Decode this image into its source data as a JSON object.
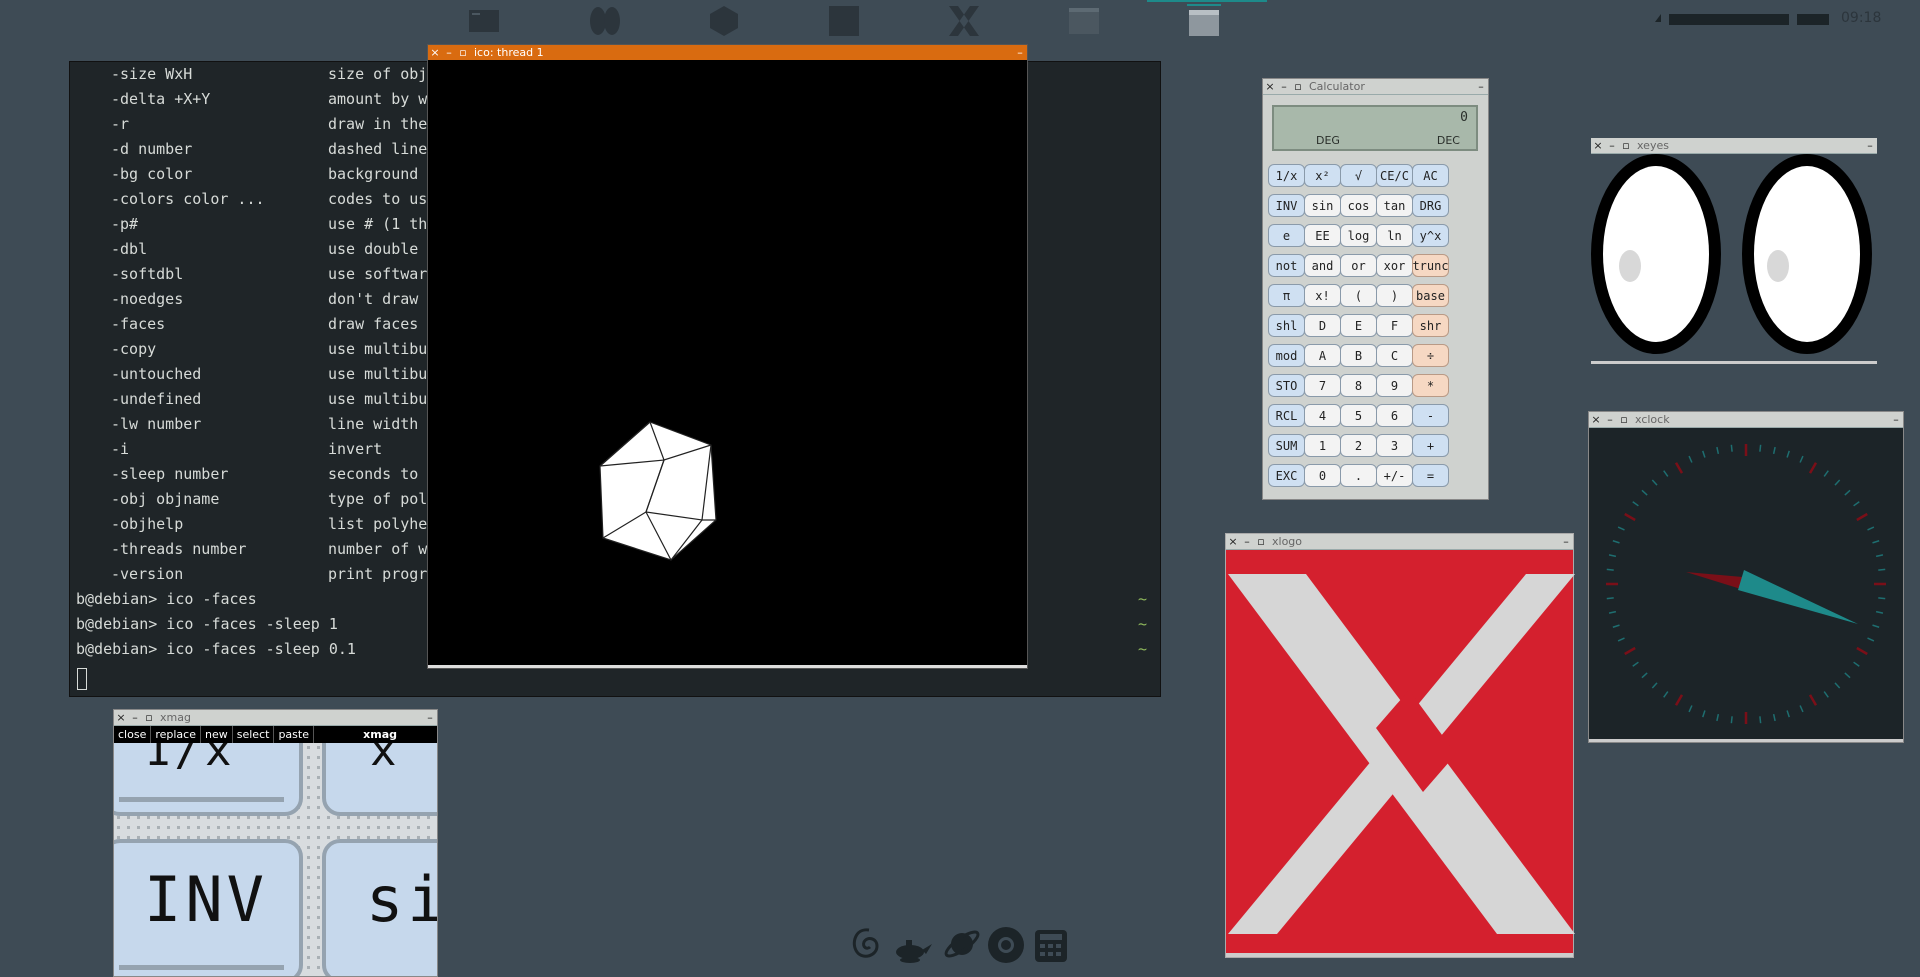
{
  "topbar": {
    "clock": "09:18"
  },
  "terminal": {
    "options": [
      {
        "name": "-size WxH",
        "desc": "size of obj"
      },
      {
        "name": "-delta +X+Y",
        "desc": "amount by w"
      },
      {
        "name": "-r",
        "desc": "draw in the"
      },
      {
        "name": "-d number",
        "desc": "dashed line"
      },
      {
        "name": "-bg color",
        "desc": "background"
      },
      {
        "name": "-colors color ...",
        "desc": "codes to us"
      },
      {
        "name": "-p#",
        "desc": "use # (1 th"
      },
      {
        "name": "-dbl",
        "desc": "use double"
      },
      {
        "name": "-softdbl",
        "desc": "use softwar"
      },
      {
        "name": "-noedges",
        "desc": "don't draw"
      },
      {
        "name": "-faces",
        "desc": "draw faces"
      },
      {
        "name": "-copy",
        "desc": "use multibu"
      },
      {
        "name": "-untouched",
        "desc": "use multibu"
      },
      {
        "name": "-undefined",
        "desc": "use multibu"
      },
      {
        "name": "-lw number",
        "desc": "line width"
      },
      {
        "name": "-i",
        "desc": "invert"
      },
      {
        "name": "-sleep number",
        "desc": "seconds to"
      },
      {
        "name": "-obj objname",
        "desc": "type of pol"
      },
      {
        "name": "-objhelp",
        "desc": "list polyhe"
      },
      {
        "name": "-threads number",
        "desc": "number of w"
      },
      {
        "name": "-version",
        "desc": "print progr"
      }
    ],
    "prompts": [
      "b@debian> ico -faces",
      "b@debian> ico -faces -sleep 1",
      "b@debian> ico -faces -sleep 0.1"
    ],
    "tilde": "~"
  },
  "ico": {
    "title": "ico: thread 1"
  },
  "calculator": {
    "title": "Calculator",
    "display_value": "0",
    "deg": "DEG",
    "dec": "DEC",
    "buttons": [
      [
        "1/x",
        "x²",
        "√",
        "CE/C",
        "AC"
      ],
      [
        "INV",
        "sin",
        "cos",
        "tan",
        "DRG"
      ],
      [
        "e",
        "EE",
        "log",
        "ln",
        "y^x"
      ],
      [
        "not",
        "and",
        "or",
        "xor",
        "trunc"
      ],
      [
        "π",
        "x!",
        "(",
        ")",
        "base"
      ],
      [
        "shl",
        "D",
        "E",
        "F",
        "shr"
      ],
      [
        "mod",
        "A",
        "B",
        "C",
        "÷"
      ],
      [
        "STO",
        "7",
        "8",
        "9",
        "*"
      ],
      [
        "RCL",
        "4",
        "5",
        "6",
        "-"
      ],
      [
        "SUM",
        "1",
        "2",
        "3",
        "+"
      ],
      [
        "EXC",
        "0",
        ".",
        "+/-",
        "="
      ]
    ]
  },
  "xeyes": {
    "title": "xeyes"
  },
  "xclock": {
    "title": "xclock"
  },
  "xlogo": {
    "title": "xlogo"
  },
  "xmag": {
    "title": "xmag",
    "menu": [
      "close",
      "replace",
      "new",
      "select",
      "paste"
    ],
    "label": "xmag",
    "magnified": [
      "1/x",
      "x",
      "INV",
      "si"
    ]
  },
  "colors": {
    "desktop": "#3e4b55",
    "ico_titlebar": "#d96b10",
    "xlogo_red": "#d4202e",
    "clock_hand": "#1e8a8a",
    "clock_hand_dark": "#7a0f18"
  }
}
